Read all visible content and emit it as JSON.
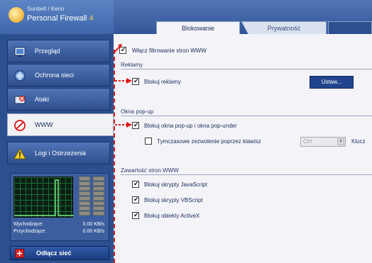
{
  "app": {
    "brand": "Sunbelt / Kerio",
    "product": "Personal Firewall",
    "version": "4"
  },
  "sidebar": {
    "items": [
      {
        "label": "Przegląd",
        "icon": "overview-icon"
      },
      {
        "label": "Ochrona sieci",
        "icon": "network-protection-icon"
      },
      {
        "label": "Ataki",
        "icon": "attacks-icon"
      },
      {
        "label": "WWW",
        "icon": "www-block-icon"
      },
      {
        "label": "Logi i Ostrzeżenia",
        "icon": "warning-icon"
      }
    ],
    "active": "WWW",
    "traffic": {
      "outgoing_label": "Wychodzące:",
      "outgoing_value": "0.00 KB/s",
      "incoming_label": "Przychodzące:",
      "incoming_value": "0.00 KB/s"
    },
    "disconnect_label": "Odłącz sieć"
  },
  "tabs": [
    {
      "label": "Blokowanie",
      "active": true
    },
    {
      "label": "Prywatność",
      "active": false
    }
  ],
  "content": {
    "enable_filtering": {
      "label": "Włącz filtrowanie stron WWW",
      "checked": true
    },
    "ads": {
      "title": "Reklamy",
      "block": {
        "label": "Blokuj reklamy",
        "checked": true
      },
      "settings_button": "Ustaw..."
    },
    "popups": {
      "title": "Okna pop-up",
      "block": {
        "label": "Blokuj okna pop-up i okna pop-under",
        "checked": true
      },
      "temp_allow": {
        "label": "Tymczasowe zezwolenie poprzez klawisz",
        "checked": false
      },
      "key_value": "Ctrl",
      "key_suffix": "Klucz"
    },
    "web_content": {
      "title": "Zawartość stron WWW",
      "items": [
        {
          "label": "Blokuj skrypty JavaScript",
          "checked": true
        },
        {
          "label": "Blokuj skrypty VBScript",
          "checked": true
        },
        {
          "label": "Blokuj obiekty ActiveX",
          "checked": true
        }
      ]
    }
  },
  "colors": {
    "sidebar": "#2b4f8f",
    "panel": "#f4f4f8",
    "accent_button": "#21458d",
    "annotation": "#e01a1a"
  }
}
